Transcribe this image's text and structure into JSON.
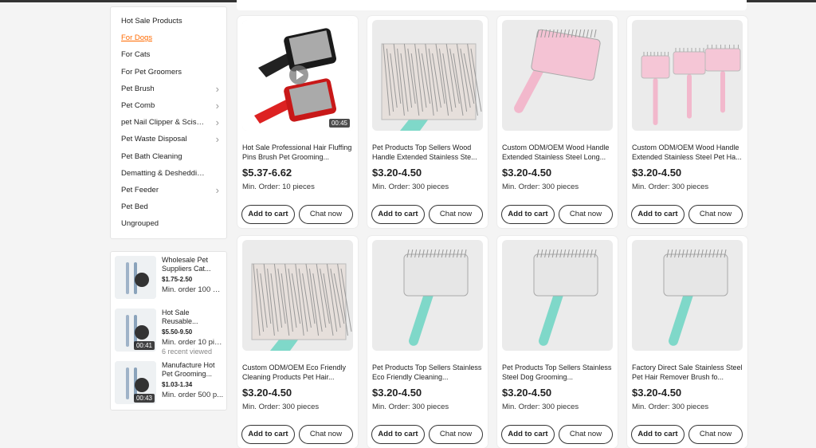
{
  "sidebar": {
    "categories": [
      {
        "label": "Hot Sale Products",
        "chevron": false,
        "active": false
      },
      {
        "label": "For Dogs",
        "chevron": false,
        "active": true
      },
      {
        "label": "For Cats",
        "chevron": false,
        "active": false
      },
      {
        "label": "For Pet Groomers",
        "chevron": false,
        "active": false
      },
      {
        "label": "Pet Brush",
        "chevron": true,
        "active": false
      },
      {
        "label": "Pet Comb",
        "chevron": true,
        "active": false
      },
      {
        "label": "pet Nail Clipper & Scissors",
        "chevron": true,
        "active": false
      },
      {
        "label": "Pet Waste Disposal",
        "chevron": true,
        "active": false
      },
      {
        "label": "Pet Bath Cleaning",
        "chevron": false,
        "active": false
      },
      {
        "label": "Dematting & Deshedding",
        "chevron": false,
        "active": false
      },
      {
        "label": "Pet Feeder",
        "chevron": true,
        "active": false
      },
      {
        "label": "Pet Bed",
        "chevron": false,
        "active": false
      },
      {
        "label": "Ungrouped",
        "chevron": false,
        "active": false
      }
    ],
    "chevron_glyph": "›",
    "accent_color": "#ff6a00"
  },
  "recommended": [
    {
      "title": "Wholesale Pet Suppliers Cat...",
      "price": "$1.75-2.50",
      "min_order": "Min. order 100 pi...",
      "viewed": "",
      "duration": ""
    },
    {
      "title": "Hot Sale Reusable...",
      "price": "$5.50-9.50",
      "min_order": "Min. order 10 pie...",
      "viewed": "6 recent viewed",
      "duration": "00:41"
    },
    {
      "title": "Manufacture Hot Pet Grooming...",
      "price": "$1.03-1.34",
      "min_order": "Min. order 500 p...",
      "viewed": "",
      "duration": "00:43"
    }
  ],
  "products": [
    {
      "title": "Hot Sale Professional Hair Fluffing Pins Brush Pet Grooming...",
      "price": "$5.37-6.62",
      "min_order": "Min. Order: 10 pieces",
      "duration": "00:45",
      "has_video": true
    },
    {
      "title": "Pet Products Top Sellers Wood Handle Extended Stainless Ste...",
      "price": "$3.20-4.50",
      "min_order": "Min. Order: 300 pieces",
      "duration": "",
      "has_video": false
    },
    {
      "title": "Custom ODM/OEM Wood Handle Extended Stainless Steel Long...",
      "price": "$3.20-4.50",
      "min_order": "Min. Order: 300 pieces",
      "duration": "",
      "has_video": false
    },
    {
      "title": "Custom ODM/OEM Wood Handle Extended Stainless Steel Pet Ha...",
      "price": "$3.20-4.50",
      "min_order": "Min. Order: 300 pieces",
      "duration": "",
      "has_video": false
    },
    {
      "title": "Custom ODM/OEM Eco Friendly Cleaning Products Pet Hair...",
      "price": "$3.20-4.50",
      "min_order": "Min. Order: 300 pieces",
      "duration": "",
      "has_video": false
    },
    {
      "title": "Pet Products Top Sellers Stainless Eco Friendly Cleaning...",
      "price": "$3.20-4.50",
      "min_order": "Min. Order: 300 pieces",
      "duration": "",
      "has_video": false
    },
    {
      "title": "Pet Products Top Sellers Stainless Steel Dog Grooming...",
      "price": "$3.20-4.50",
      "min_order": "Min. Order: 300 pieces",
      "duration": "",
      "has_video": false
    },
    {
      "title": "Factory Direct Sale Stainless Steel Pet Hair Remover Brush fo...",
      "price": "$3.20-4.50",
      "min_order": "Min. Order: 300 pieces",
      "duration": "",
      "has_video": false
    }
  ],
  "buttons": {
    "add_to_cart": "Add to cart",
    "chat_now": "Chat now"
  },
  "product_images": [
    "slicker-brush-black-red-icon",
    "slicker-brush-teal-closeup-icon",
    "slicker-brush-pink-icon",
    "slicker-brush-pink-set-icon",
    "slicker-brush-teal-closeup-icon",
    "slicker-brush-teal-angled-icon",
    "slicker-brush-teal-back-icon",
    "slicker-brush-teal-icon"
  ]
}
